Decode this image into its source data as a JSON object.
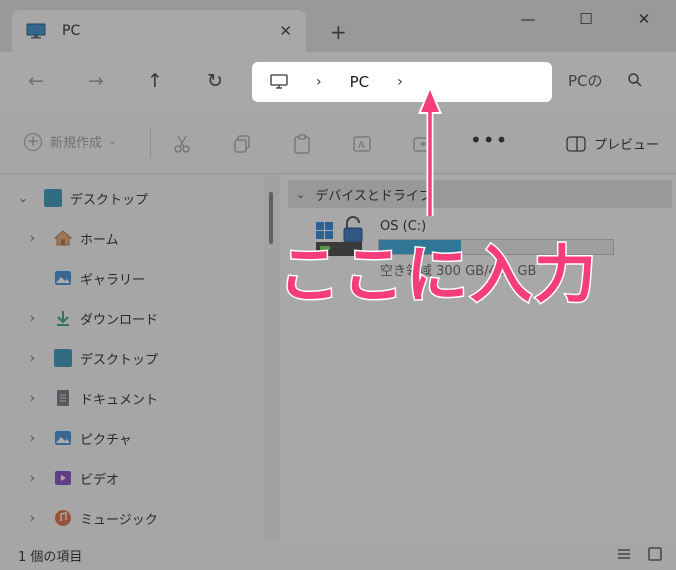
{
  "tab": {
    "title": "PC",
    "close_label": "✕",
    "new_tab_label": "+"
  },
  "window_controls": {
    "minimize": "—",
    "maximize": "☐",
    "close": "✕"
  },
  "navigation": {
    "back": "←",
    "forward": "→",
    "up": "↑",
    "refresh": "↻"
  },
  "address_bar": {
    "separator": "›",
    "crumbs": [
      "PC"
    ]
  },
  "search": {
    "text": "PCの"
  },
  "toolbar": {
    "new_label": "新規作成",
    "more_label": "•••",
    "preview_label": "プレビュー"
  },
  "sidebar": {
    "items": [
      {
        "label": "デスクトップ",
        "icon": "desktop-folder-icon",
        "expanded": true
      },
      {
        "label": "ホーム",
        "icon": "home-icon"
      },
      {
        "label": "ギャラリー",
        "icon": "gallery-icon"
      },
      {
        "label": "ダウンロード",
        "icon": "download-icon"
      },
      {
        "label": "デスクトップ",
        "icon": "desktop-icon"
      },
      {
        "label": "ドキュメント",
        "icon": "document-icon"
      },
      {
        "label": "ピクチャ",
        "icon": "pictures-icon"
      },
      {
        "label": "ビデオ",
        "icon": "videos-icon"
      },
      {
        "label": "ミュージック",
        "icon": "music-icon"
      }
    ]
  },
  "content": {
    "group_title": "デバイスとドライブ",
    "drive": {
      "name": "OS (C:)",
      "space_text": "空き領域 300 GB/461 GB",
      "used_fraction": 0.35
    }
  },
  "status": {
    "item_count": "1 個の項目"
  },
  "annotation": {
    "text": "ここに入力",
    "color": "#f53d7a"
  },
  "colors": {
    "accent": "#26a0da",
    "annotation": "#f53d7a"
  }
}
